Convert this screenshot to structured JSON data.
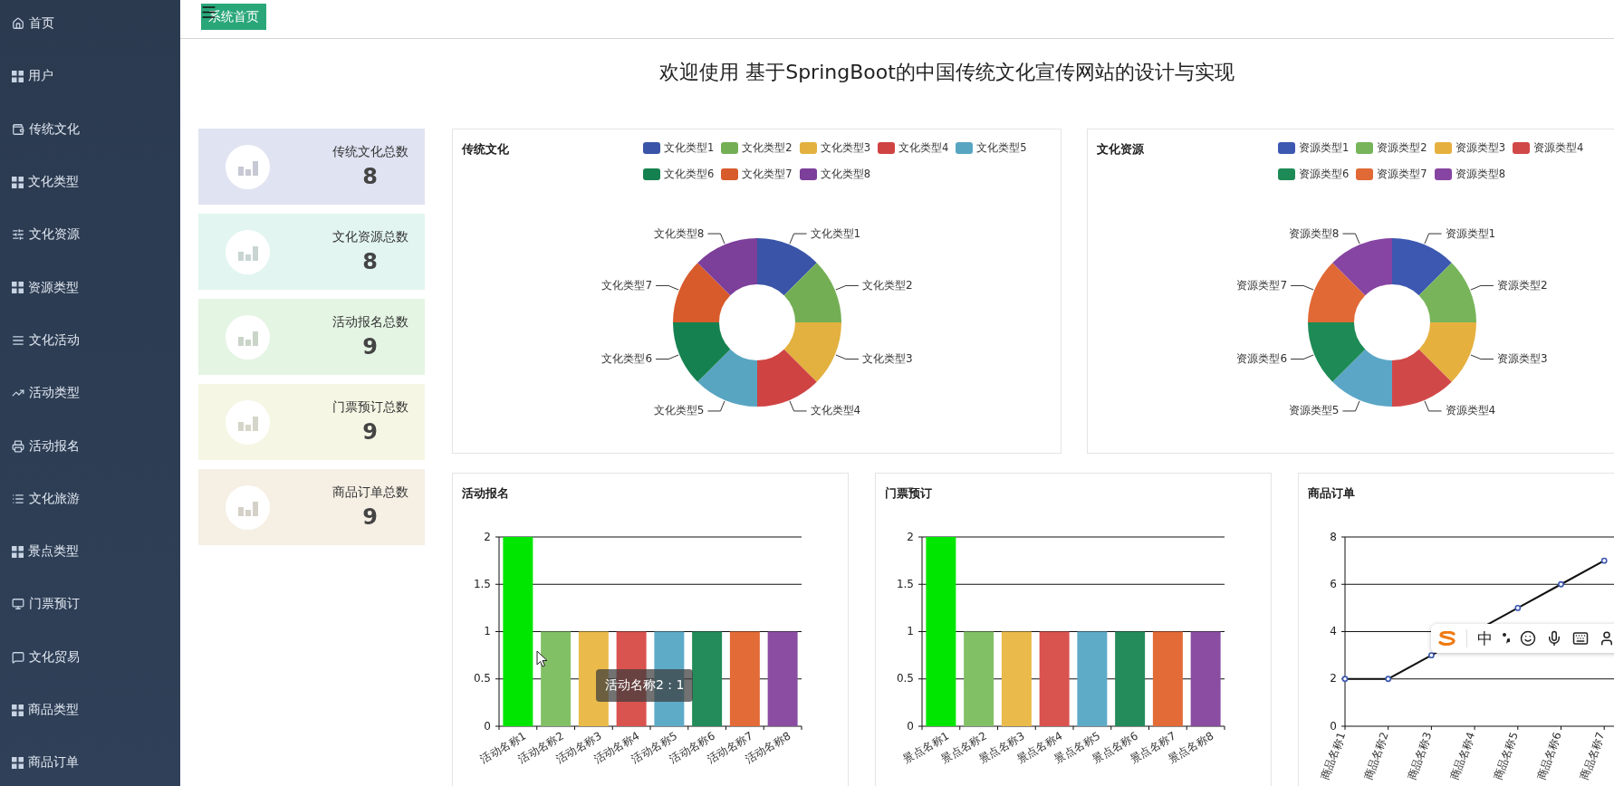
{
  "sidebar": {
    "items": [
      {
        "label": "首页"
      },
      {
        "label": "用户"
      },
      {
        "label": "传统文化"
      },
      {
        "label": "文化类型"
      },
      {
        "label": "文化资源"
      },
      {
        "label": "资源类型"
      },
      {
        "label": "文化活动"
      },
      {
        "label": "活动类型"
      },
      {
        "label": "活动报名"
      },
      {
        "label": "文化旅游"
      },
      {
        "label": "景点类型"
      },
      {
        "label": "门票预订"
      },
      {
        "label": "文化贸易"
      },
      {
        "label": "商品类型"
      },
      {
        "label": "商品订单"
      }
    ]
  },
  "top_bar": {
    "tag": "系统首页"
  },
  "page_title": "欢迎使用 基于SpringBoot的中国传统文化宣传网站的设计与实现",
  "stat_cards": [
    {
      "label": "传统文化总数",
      "value": "8",
      "color": "#e0e3f2"
    },
    {
      "label": "文化资源总数",
      "value": "8",
      "color": "#e2f5f1"
    },
    {
      "label": "活动报名总数",
      "value": "9",
      "color": "#e4f5e3"
    },
    {
      "label": "门票预订总数",
      "value": "9",
      "color": "#f5f6e4"
    },
    {
      "label": "商品订单总数",
      "value": "9",
      "color": "#f5efe4"
    }
  ],
  "pie_panels": [
    {
      "title": "传统文化",
      "legend_rows": [
        [
          {
            "label": "文化类型1",
            "color": "#3a54a8"
          },
          {
            "label": "文化类型2",
            "color": "#73ae55"
          },
          {
            "label": "文化类型3",
            "color": "#e3b13f"
          },
          {
            "label": "文化类型4",
            "color": "#cf4343"
          },
          {
            "label": "文化类型5",
            "color": "#58a5c2"
          }
        ],
        [
          {
            "label": "文化类型6",
            "color": "#168150"
          },
          {
            "label": "文化类型7",
            "color": "#d85b2b"
          },
          {
            "label": "文化类型8",
            "color": "#7c3f9a"
          }
        ]
      ],
      "chart_data": {
        "type": "donut",
        "categories": [
          "文化类型1",
          "文化类型2",
          "文化类型3",
          "文化类型4",
          "文化类型5",
          "文化类型6",
          "文化类型7",
          "文化类型8"
        ],
        "values": [
          1,
          1,
          1,
          1,
          1,
          1,
          1,
          1
        ],
        "colors": [
          "#3a54a8",
          "#73ae55",
          "#e3b13f",
          "#cf4343",
          "#58a5c2",
          "#168150",
          "#d85b2b",
          "#7c3f9a"
        ]
      }
    },
    {
      "title": "文化资源",
      "legend_rows": [
        [
          {
            "label": "资源类型1",
            "color": "#3d58b0"
          },
          {
            "label": "资源类型2",
            "color": "#77b45a"
          },
          {
            "label": "资源类型3",
            "color": "#e6b03e"
          },
          {
            "label": "资源类型4",
            "color": "#d14848"
          }
        ],
        [
          {
            "label": "资源类型6",
            "color": "#1e8a55"
          },
          {
            "label": "资源类型7",
            "color": "#e06935"
          },
          {
            "label": "资源类型8",
            "color": "#8645a2"
          }
        ]
      ],
      "chart_data": {
        "type": "donut",
        "categories": [
          "资源类型1",
          "资源类型2",
          "资源类型3",
          "资源类型4",
          "资源类型5",
          "资源类型6",
          "资源类型7",
          "资源类型8"
        ],
        "values": [
          1,
          1,
          1,
          1,
          1,
          1,
          1,
          1
        ],
        "colors": [
          "#3d58b0",
          "#77b45a",
          "#e6b03e",
          "#d14848",
          "#5ba6c6",
          "#1e8a55",
          "#e06935",
          "#8645a2"
        ]
      }
    }
  ],
  "bar_panels": [
    {
      "title": "活动报名",
      "tooltip": "活动名称2 : 1",
      "chart_data": {
        "type": "bar",
        "categories": [
          "活动名称1",
          "活动名称2",
          "活动名称3",
          "活动名称4",
          "活动名称5",
          "活动名称6",
          "活动名称7",
          "活动名称8"
        ],
        "values": [
          2,
          1,
          1,
          1,
          1,
          1,
          1,
          1
        ],
        "colors": [
          "#00e600",
          "#82c065",
          "#eabb4a",
          "#d9534f",
          "#5eabc8",
          "#238c5a",
          "#e36b37",
          "#8a4da2"
        ],
        "ylim": [
          0,
          2
        ],
        "yticks": [
          0,
          0.5,
          1,
          1.5,
          2
        ],
        "grid": true
      }
    },
    {
      "title": "门票预订",
      "chart_data": {
        "type": "bar",
        "categories": [
          "景点名称1",
          "景点名称2",
          "景点名称3",
          "景点名称4",
          "景点名称5",
          "景点名称6",
          "景点名称7",
          "景点名称8"
        ],
        "values": [
          2,
          1,
          1,
          1,
          1,
          1,
          1,
          1
        ],
        "colors": [
          "#00e600",
          "#82c065",
          "#eabb4a",
          "#d9534f",
          "#5eabc8",
          "#238c5a",
          "#e36b37",
          "#8a4da2"
        ],
        "ylim": [
          0,
          2
        ],
        "yticks": [
          0,
          0.5,
          1,
          1.5,
          2
        ],
        "grid": true
      }
    }
  ],
  "line_panel": {
    "title": "商品订单",
    "chart_data": {
      "type": "line",
      "categories": [
        "商品名称1",
        "商品名称2",
        "商品名称3",
        "商品名称4",
        "商品名称5",
        "商品名称6",
        "商品名称7"
      ],
      "series": [
        {
          "color": "#111111",
          "marker": "circle",
          "values": [
            2,
            2,
            3,
            null,
            5,
            6,
            7
          ]
        }
      ],
      "ylim": [
        0,
        8
      ],
      "yticks": [
        0,
        2,
        4,
        6,
        8
      ],
      "grid": true
    }
  },
  "ime_toolbar": {
    "mode": "中"
  }
}
